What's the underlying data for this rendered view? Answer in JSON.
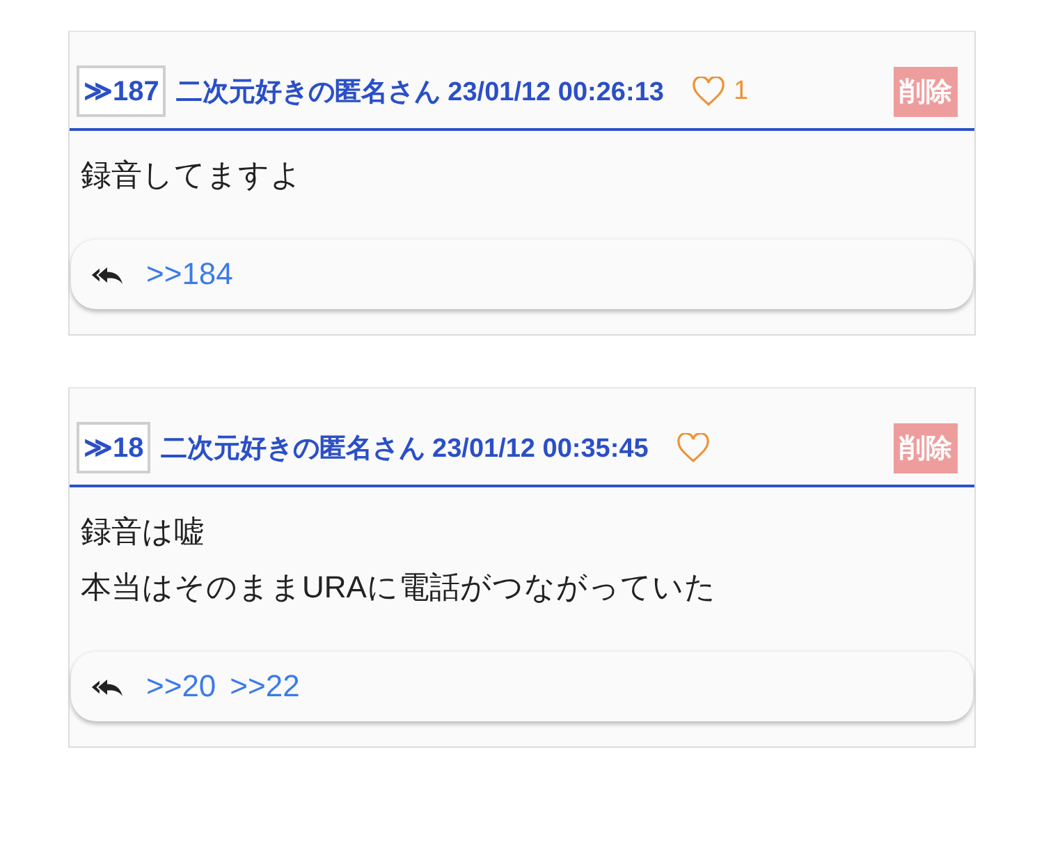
{
  "posts": [
    {
      "number": "≫187",
      "author_date": "二次元好きの匿名さん 23/01/12 00:26:13",
      "likes": "1",
      "delete_label": "削除",
      "body": [
        "録音してますよ"
      ],
      "replies": [
        ">>184"
      ]
    },
    {
      "number": "≫18",
      "author_date": "二次元好きの匿名さん 23/01/12 00:35:45",
      "delete_label": "削除",
      "body": [
        "録音は嘘",
        "本当はそのままURAに電話がつながっていた"
      ],
      "replies": [
        ">>20",
        ">>22"
      ]
    }
  ]
}
